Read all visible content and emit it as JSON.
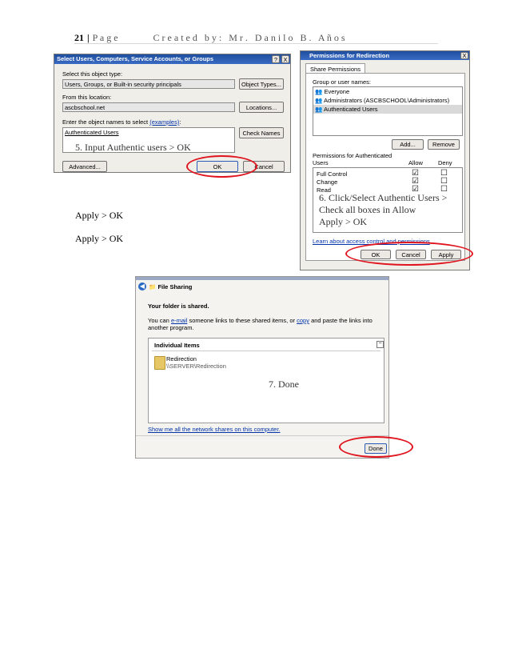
{
  "header": {
    "page_number": "21",
    "separator": "|",
    "page_word": "P a g e",
    "created_by": "C r e a t e d   b y :   M r .   D a n i l o   B .   A ñ o s"
  },
  "select_dialog": {
    "title": "Select Users, Computers, Service Accounts, or Groups",
    "help_btn": "?",
    "close_btn": "X",
    "object_type_label": "Select this object type:",
    "object_type_value": "Users, Groups, or Built-in security principals",
    "object_types_button": "Object Types...",
    "location_label": "From this location:",
    "location_value": "ascbschool.net",
    "locations_button": "Locations...",
    "names_label": "Enter the object names to select",
    "names_label_link": "(examples)",
    "names_label_suffix": ":",
    "names_value": "Authenticated Users",
    "check_names_button": "Check Names",
    "advanced_button": "Advanced...",
    "ok_button": "OK",
    "cancel_button": "Cancel"
  },
  "caption5": "5. Input Authentic users > OK",
  "permissions_dialog": {
    "title": "Permissions for Redirection",
    "close_btn": "X",
    "tab": "Share Permissions",
    "group_label": "Group or user names:",
    "users": [
      "Everyone",
      "Administrators (ASCBSCHOOL\\Administrators)",
      "Authenticated Users"
    ],
    "add_button": "Add...",
    "remove_button": "Remove",
    "perm_label_line1": "Permissions for Authenticated",
    "perm_label_line2": "Users",
    "allow_header": "Allow",
    "deny_header": "Deny",
    "permissions": [
      {
        "name": "Full Control",
        "allow": "☑",
        "deny": "☐"
      },
      {
        "name": "Change",
        "allow": "☑",
        "deny": "☐"
      },
      {
        "name": "Read",
        "allow": "☑",
        "deny": "☐"
      }
    ],
    "learn_link": "Learn about access control and permissions",
    "ok_button": "OK",
    "cancel_button": "Cancel",
    "apply_button": "Apply"
  },
  "caption6": {
    "line1": "6. Click/Select Authentic Users >",
    "line2": "Check all boxes in Allow",
    "line3": "Apply > OK"
  },
  "apply_ok_1": "Apply > OK",
  "apply_ok_2": "Apply > OK",
  "file_sharing": {
    "title": "File Sharing",
    "shared_msg": "Your folder is shared.",
    "you_can": "You can",
    "email_link": "e-mail",
    "someone": "someone links to these shared items, or",
    "copy_link": "copy",
    "rest": "and paste the links into another program.",
    "individual_items": "Individual Items",
    "folder_name": "Redirection",
    "folder_path": "\\\\SERVER\\Redirection",
    "show_link": "Show me all the network shares on this computer.",
    "done_button": "Done"
  },
  "caption7": "7. Done"
}
